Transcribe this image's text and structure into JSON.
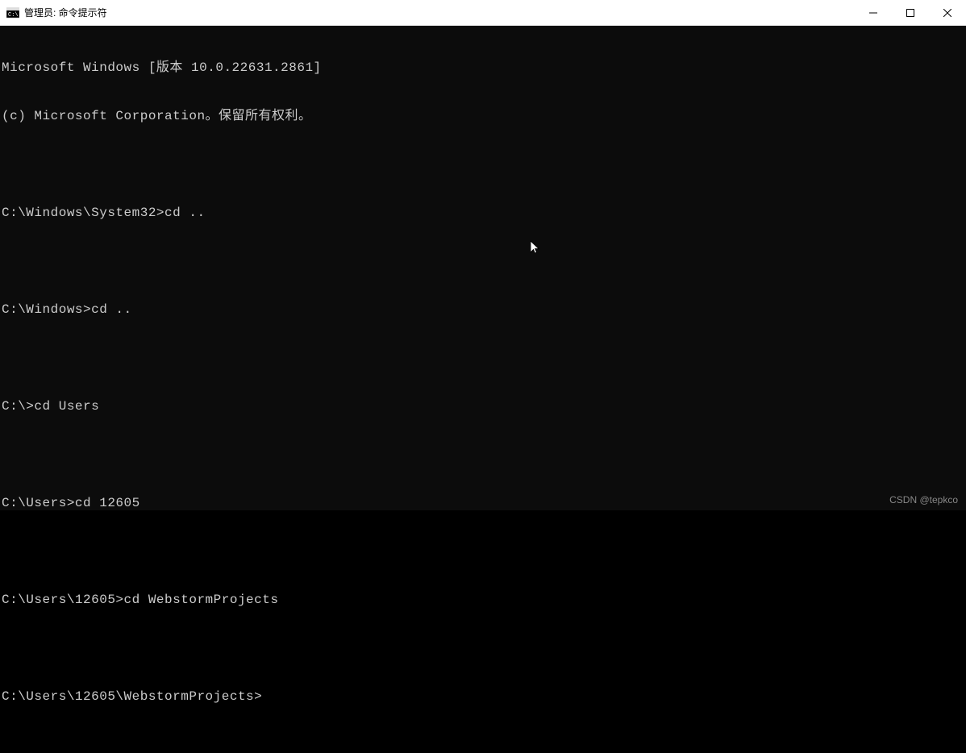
{
  "titlebar": {
    "title": "管理员: 命令提示符"
  },
  "terminal": {
    "lines": [
      "Microsoft Windows [版本 10.0.22631.2861]",
      "(c) Microsoft Corporation。保留所有权利。",
      "",
      "C:\\Windows\\System32>cd ..",
      "",
      "C:\\Windows>cd ..",
      "",
      "C:\\>cd Users",
      "",
      "C:\\Users>cd 12605",
      "",
      "C:\\Users\\12605>cd WebstormProjects",
      "",
      "C:\\Users\\12605\\WebstormProjects>"
    ]
  },
  "watermark": "CSDN @tepkco"
}
